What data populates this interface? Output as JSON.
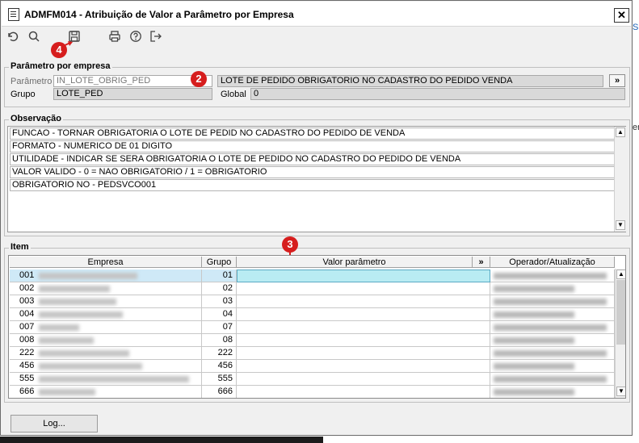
{
  "window": {
    "title": "ADMFM014 - Atribuição de Valor a Parâmetro por Empresa",
    "close_label": "✕"
  },
  "toolbar": {
    "icons": [
      "undo-icon",
      "search-icon",
      "save-icon",
      "print-icon",
      "help-icon",
      "exit-icon"
    ]
  },
  "markers": {
    "save": "4",
    "parametro": "2",
    "valor": "3"
  },
  "parametro_section": {
    "legend": "Parâmetro por empresa",
    "parametro_label": "Parâmetro",
    "parametro_value": "IN_LOTE_OBRIG_PED",
    "parametro_desc": "LOTE DE PEDIDO OBRIGATORIO NO CADASTRO DO PEDIDO VENDA",
    "expand_label": "»",
    "grupo_label": "Grupo",
    "grupo_value": "LOTE_PED",
    "global_label": "Global",
    "global_value": "0"
  },
  "observacao": {
    "legend": "Observação",
    "lines": [
      "FUNCAO - TORNAR OBRIGATORIA O LOTE DE PEDID NO CADASTRO DO PEDIDO DE VENDA",
      "FORMATO - NUMERICO DE 01 DIGITO",
      "UTILIDADE - INDICAR SE SERA OBRIGATORIA O LOTE DE PEDIDO NO CADASTRO DO PEDIDO DE VENDA",
      "VALOR VALIDO - 0 = NAO OBRIGATORIO / 1 = OBRIGATORIO",
      "OBRIGATORIO NO - PEDSVCO001"
    ]
  },
  "item": {
    "legend": "Item",
    "columns": {
      "empresa": "Empresa",
      "grupo": "Grupo",
      "valor": "Valor parâmetro",
      "expand": "»",
      "operador": "Operador/Atualização"
    },
    "rows": [
      {
        "codigo": "001",
        "grupo": "01",
        "valor": ""
      },
      {
        "codigo": "002",
        "grupo": "02",
        "valor": ""
      },
      {
        "codigo": "003",
        "grupo": "03",
        "valor": ""
      },
      {
        "codigo": "004",
        "grupo": "04",
        "valor": ""
      },
      {
        "codigo": "007",
        "grupo": "07",
        "valor": ""
      },
      {
        "codigo": "008",
        "grupo": "08",
        "valor": ""
      },
      {
        "codigo": "222",
        "grupo": "222",
        "valor": ""
      },
      {
        "codigo": "456",
        "grupo": "456",
        "valor": ""
      },
      {
        "codigo": "555",
        "grupo": "555",
        "valor": ""
      },
      {
        "codigo": "666",
        "grupo": "666",
        "valor": ""
      }
    ]
  },
  "footer": {
    "log_button": "Log..."
  },
  "background": {
    "edge_text_1": "Si",
    "edge_text_2": "er"
  },
  "colors": {
    "selected_row": "#cfe9f7",
    "valor_cell_selected": "#b9ecf3",
    "marker": "#d61d1d"
  }
}
